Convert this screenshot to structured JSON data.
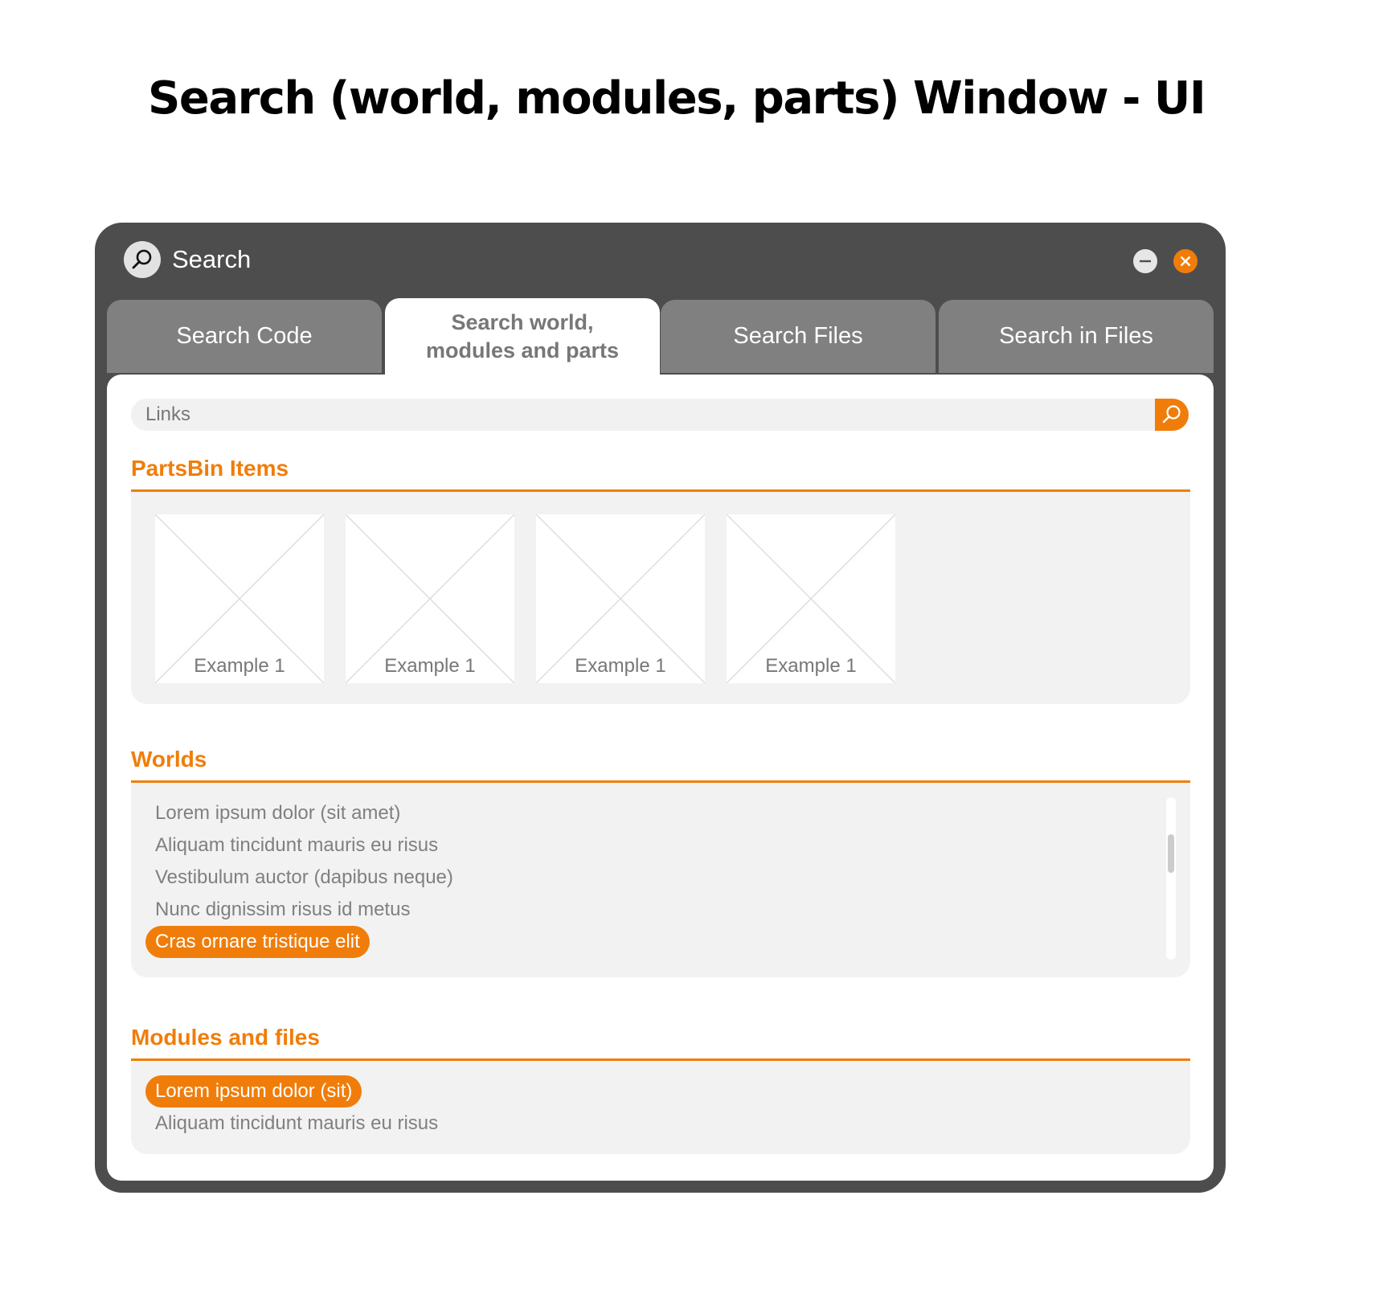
{
  "page_heading": "Search (world, modules, parts) Window - UI",
  "window": {
    "title": "Search",
    "title_icon": "search-icon",
    "controls": {
      "minimize_icon": "minimize-icon",
      "close_icon": "close-icon"
    }
  },
  "tabs": [
    {
      "label": "Search Code",
      "active": false
    },
    {
      "label": "Search world, modules and parts",
      "active": true
    },
    {
      "label": "Search Files",
      "active": false
    },
    {
      "label": "Search in Files",
      "active": false
    }
  ],
  "search": {
    "value": "Links",
    "button_icon": "search-icon"
  },
  "sections": {
    "partsbin": {
      "title": "PartsBin Items",
      "items": [
        {
          "label": "Example 1",
          "image": "placeholder-image"
        },
        {
          "label": "Example 1",
          "image": "placeholder-image"
        },
        {
          "label": "Example 1",
          "image": "placeholder-image"
        },
        {
          "label": "Example 1",
          "image": "placeholder-image"
        }
      ]
    },
    "worlds": {
      "title": "Worlds",
      "items": [
        {
          "label": "Lorem ipsum dolor (sit amet)",
          "selected": false
        },
        {
          "label": "Aliquam tincidunt mauris eu risus",
          "selected": false
        },
        {
          "label": "Vestibulum auctor (dapibus neque)",
          "selected": false
        },
        {
          "label": "Nunc dignissim risus id metus",
          "selected": false
        },
        {
          "label": "Cras ornare tristique elit",
          "selected": true
        }
      ]
    },
    "modules": {
      "title": "Modules and files",
      "items": [
        {
          "label": "Lorem ipsum dolor (sit)",
          "selected": true
        },
        {
          "label": "Aliquam tincidunt mauris eu risus",
          "selected": false
        }
      ]
    }
  },
  "colors": {
    "accent": "#f07d0a",
    "window_frame": "#4d4d4d",
    "tab_inactive": "#808080",
    "panel_bg": "#f2f2f2"
  }
}
